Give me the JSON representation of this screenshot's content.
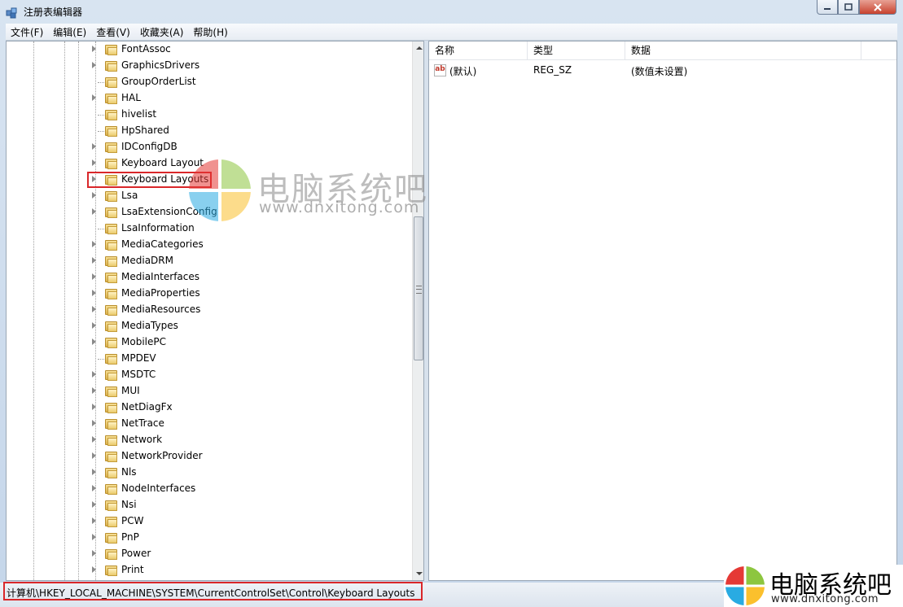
{
  "window": {
    "title": "注册表编辑器",
    "minimize_icon": "minimize-icon",
    "maximize_icon": "maximize-icon",
    "close_icon": "close-icon"
  },
  "menu": [
    "文件(F)",
    "编辑(E)",
    "查看(V)",
    "收藏夹(A)",
    "帮助(H)"
  ],
  "tree": {
    "items": [
      {
        "label": "FontAssoc",
        "expandable": true
      },
      {
        "label": "GraphicsDrivers",
        "expandable": true
      },
      {
        "label": "GroupOrderList",
        "expandable": false
      },
      {
        "label": "HAL",
        "expandable": true
      },
      {
        "label": "hivelist",
        "expandable": false
      },
      {
        "label": "HpShared",
        "expandable": false
      },
      {
        "label": "IDConfigDB",
        "expandable": true
      },
      {
        "label": "Keyboard Layout",
        "expandable": true
      },
      {
        "label": "Keyboard Layouts",
        "expandable": true,
        "selected": true
      },
      {
        "label": "Lsa",
        "expandable": true
      },
      {
        "label": "LsaExtensionConfig",
        "expandable": true
      },
      {
        "label": "LsaInformation",
        "expandable": false
      },
      {
        "label": "MediaCategories",
        "expandable": true
      },
      {
        "label": "MediaDRM",
        "expandable": true
      },
      {
        "label": "MediaInterfaces",
        "expandable": true
      },
      {
        "label": "MediaProperties",
        "expandable": true
      },
      {
        "label": "MediaResources",
        "expandable": true
      },
      {
        "label": "MediaTypes",
        "expandable": true
      },
      {
        "label": "MobilePC",
        "expandable": true
      },
      {
        "label": "MPDEV",
        "expandable": false
      },
      {
        "label": "MSDTC",
        "expandable": true
      },
      {
        "label": "MUI",
        "expandable": true
      },
      {
        "label": "NetDiagFx",
        "expandable": true
      },
      {
        "label": "NetTrace",
        "expandable": true
      },
      {
        "label": "Network",
        "expandable": true
      },
      {
        "label": "NetworkProvider",
        "expandable": true
      },
      {
        "label": "Nls",
        "expandable": true
      },
      {
        "label": "NodeInterfaces",
        "expandable": true
      },
      {
        "label": "Nsi",
        "expandable": true
      },
      {
        "label": "PCW",
        "expandable": true
      },
      {
        "label": "PnP",
        "expandable": true
      },
      {
        "label": "Power",
        "expandable": true
      },
      {
        "label": "Print",
        "expandable": true
      }
    ]
  },
  "list": {
    "columns": [
      "名称",
      "类型",
      "数据"
    ],
    "rows": [
      {
        "name": "(默认)",
        "type": "REG_SZ",
        "data": "(数值未设置)",
        "icon": "ab-string-icon"
      }
    ]
  },
  "status": {
    "path": "计算机\\HKEY_LOCAL_MACHINE\\SYSTEM\\CurrentControlSet\\Control\\Keyboard Layouts"
  },
  "watermark": {
    "title": "电脑系统吧",
    "url": "www.dnxitong.com"
  },
  "colors": {
    "highlight": "#d9272a",
    "logo_green": "#8dc63f",
    "logo_blue": "#29abe2",
    "logo_yellow": "#fbc02d",
    "logo_red": "#e53935"
  }
}
